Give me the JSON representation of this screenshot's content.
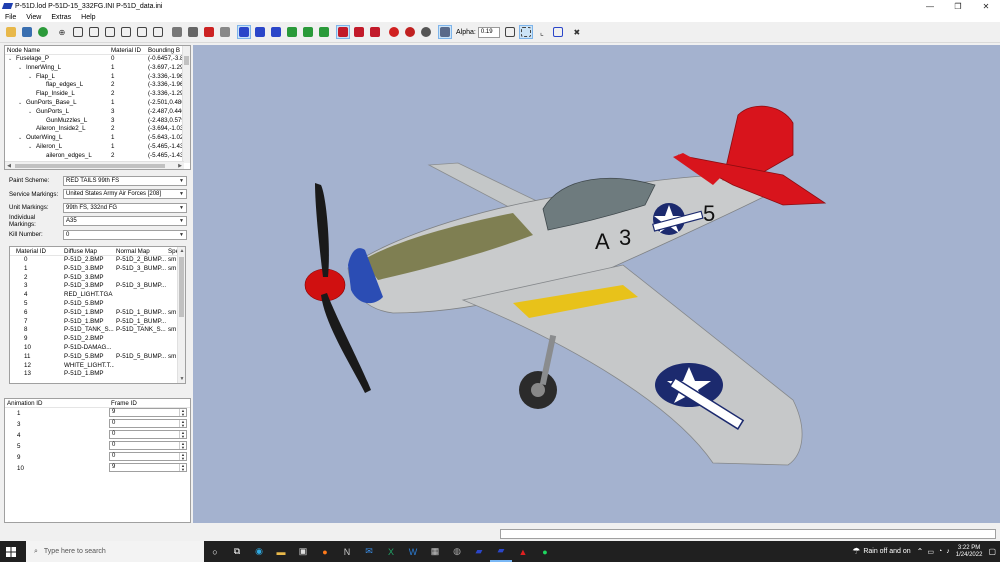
{
  "window": {
    "title": "P-51D.lod  P-51D-15_332FG.INI  P-51D_data.ini",
    "minimize": "—",
    "maximize": "❐",
    "close": "✕"
  },
  "menu": [
    "File",
    "View",
    "Extras",
    "Help"
  ],
  "toolbar": {
    "alpha_label": "Alpha:",
    "alpha_value": "0.19"
  },
  "node_tree": {
    "headers": [
      "Node Name",
      "Material ID",
      "Bounding B"
    ],
    "rows": [
      {
        "toggle": "⌄",
        "name": "Fuselage_P",
        "material": "0",
        "bbox": "(-0.6457,-3.8"
      },
      {
        "toggle": "⌄",
        "name": "InnerWing_L",
        "material": "1",
        "bbox": "(-3.697,-1.29"
      },
      {
        "toggle": "⌄",
        "name": "Flap_L",
        "material": "1",
        "bbox": "(-3.336,-1.96"
      },
      {
        "toggle": "",
        "name": "flap_edges_L",
        "material": "2",
        "bbox": "(-3.336,-1.96"
      },
      {
        "toggle": "",
        "name": "Flap_Inside_L",
        "material": "2",
        "bbox": "(-3.336,-1.29"
      },
      {
        "toggle": "⌄",
        "name": "GunPorts_Base_L",
        "material": "1",
        "bbox": "(-2.501,0.480"
      },
      {
        "toggle": "⌄",
        "name": "GunPorts_L",
        "material": "3",
        "bbox": "(-2.487,0.446"
      },
      {
        "toggle": "",
        "name": "GunMuzzles_L",
        "material": "3",
        "bbox": "(-2.483,0.579"
      },
      {
        "toggle": "",
        "name": "Aileron_Inside2_L",
        "material": "2",
        "bbox": "(-3.694,-1.03"
      },
      {
        "toggle": "⌄",
        "name": "OuterWing_L",
        "material": "1",
        "bbox": "(-5.643,-1.02"
      },
      {
        "toggle": "⌄",
        "name": "Aileron_L",
        "material": "1",
        "bbox": "(-5.465,-1.43"
      },
      {
        "toggle": "",
        "name": "aileron_edges_L",
        "material": "2",
        "bbox": "(-5.465,-1.43"
      }
    ]
  },
  "properties": [
    {
      "label": "Paint Scheme:",
      "value": "RED TAILS 99th FS"
    },
    {
      "label": "Service Markings:",
      "value": "United States Army Air Forces [208]"
    },
    {
      "label": "Unit Markings:",
      "value": "99th FS, 332nd FG"
    },
    {
      "label": "Individual Markings:",
      "value": "A35"
    },
    {
      "label": "Kill Number:",
      "value": "0"
    }
  ],
  "materials": {
    "headers": [
      "Material ID",
      "Diffuse Map",
      "Normal Map",
      "Spe"
    ],
    "rows": [
      [
        "0",
        "P-51D_2.BMP",
        "P-51D_2_BUMP....",
        "sm"
      ],
      [
        "1",
        "P-51D_3.BMP",
        "P-51D_3_BUMP....",
        "sm"
      ],
      [
        "2",
        "P-51D_3.BMP",
        "",
        ""
      ],
      [
        "3",
        "P-51D_3.BMP",
        "P-51D_3_BUMP....",
        ""
      ],
      [
        "4",
        "RED_LIGHT.TGA",
        "",
        ""
      ],
      [
        "5",
        "P-51D_5.BMP",
        "",
        ""
      ],
      [
        "6",
        "P-51D_1.BMP",
        "P-51D_1_BUMP....",
        "sm"
      ],
      [
        "7",
        "P-51D_1.BMP",
        "P-51D_1_BUMP....",
        ""
      ],
      [
        "8",
        "P-51D_TANK_S...",
        "P-51D_TANK_S...",
        "sm"
      ],
      [
        "9",
        "P-51D_2.BMP",
        "",
        ""
      ],
      [
        "10",
        "P-51D-DAMAG...",
        "",
        ""
      ],
      [
        "11",
        "P-51D_5.BMP",
        "P-51D_5_BUMP....",
        "sm"
      ],
      [
        "12",
        "WHITE_LIGHT.T...",
        "",
        ""
      ],
      [
        "13",
        "P-51D_1.BMP",
        "",
        ""
      ]
    ]
  },
  "animations": {
    "headers": [
      "Animation ID",
      "Frame ID"
    ],
    "rows": [
      [
        "1",
        "9"
      ],
      [
        "3",
        "0"
      ],
      [
        "4",
        "0"
      ],
      [
        "5",
        "0"
      ],
      [
        "9",
        "0"
      ],
      [
        "10",
        "9"
      ]
    ]
  },
  "aircraft": {
    "code_letter": "A",
    "code_num1": "3",
    "code_num2": "5",
    "colors": {
      "tail": "#d8141c",
      "nose": "#d01010",
      "stripe": "#e8c21a",
      "insignia": "#1c2a6e",
      "bg": "#a4b2cf"
    }
  },
  "taskbar": {
    "search_placeholder": "Type here to search",
    "weather": "Rain off and on",
    "time": "3:22 PM",
    "date": "1/24/2022"
  }
}
